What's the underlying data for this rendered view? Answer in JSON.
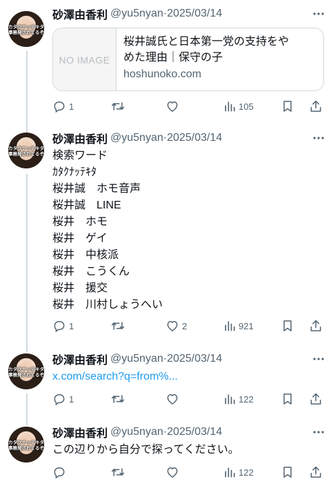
{
  "author": {
    "name": "砂澤由香利",
    "handle": "@yu5nyan",
    "separator": "·",
    "avatar_caption_line1": "カタクナッテキタ",
    "avatar_caption_line2": "事務発されてるぞ"
  },
  "tweets": [
    {
      "date": "2025/03/14",
      "card": {
        "thumb_label": "NO IMAGE",
        "title_line1": "桜井誠氏と日本第一党の支持をや",
        "title_line2": "めた理由｜保守の子",
        "domain": "hoshunoko.com"
      },
      "replies": "1",
      "retweets": "",
      "likes": "",
      "views": "105"
    },
    {
      "date": "2025/03/14",
      "lines": [
        "検索ワード",
        "ｶﾀｸﾅｯﾃｷﾀ",
        "桜井誠　ホモ音声",
        "桜井誠　LINE",
        "桜井　ホモ",
        "桜井　ゲイ",
        "桜井　中核派",
        "桜井　こうくん",
        "桜井　援交",
        "桜井　川村しょうへい"
      ],
      "replies": "1",
      "retweets": "",
      "likes": "2",
      "views": "921"
    },
    {
      "date": "2025/03/14",
      "link": "x.com/search?q=from%...",
      "replies": "1",
      "retweets": "",
      "likes": "",
      "views": "122"
    },
    {
      "date": "2025/03/14",
      "text": "この辺りから自分で探ってください。",
      "replies": "",
      "retweets": "",
      "likes": "",
      "views": "122"
    }
  ],
  "icons": {
    "more": "more-dots-icon",
    "reply": "reply-bubble-icon",
    "retweet": "retweet-arrows-icon",
    "like": "heart-icon",
    "views": "bar-chart-icon",
    "bookmark": "bookmark-icon",
    "share": "share-arrow-icon"
  },
  "colors": {
    "text": "#0f1419",
    "secondary": "#536471",
    "link": "#1d9bf0",
    "border": "#cfd9de"
  }
}
